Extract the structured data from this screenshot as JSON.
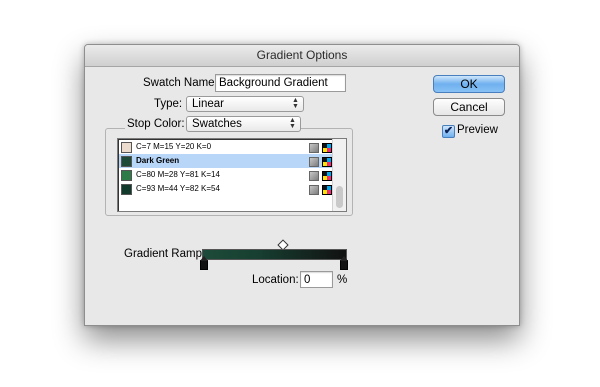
{
  "window": {
    "title": "Gradient Options"
  },
  "swatch_name": {
    "label": "Swatch Name:",
    "value": "Background Gradient"
  },
  "type": {
    "label": "Type:",
    "selected": "Linear"
  },
  "stop_color": {
    "label": "Stop Color:",
    "selected": "Swatches"
  },
  "swatches": [
    {
      "name": "C=7 M=15 Y=20 K=0",
      "color": "#ebdccd",
      "selected": false
    },
    {
      "name": "Dark Green",
      "color": "#1d4a38",
      "selected": true
    },
    {
      "name": "C=80 M=28 Y=81 K=14",
      "color": "#2f7b48",
      "selected": false
    },
    {
      "name": "C=93 M=44 Y=82 K=54",
      "color": "#123a2c",
      "selected": false
    }
  ],
  "gradient_ramp": {
    "label": "Gradient Ramp"
  },
  "location": {
    "label": "Location:",
    "value": "0",
    "unit": "%"
  },
  "buttons": {
    "ok": "OK",
    "cancel": "Cancel"
  },
  "preview": {
    "label": "Preview",
    "checked": true,
    "check_glyph": "✔"
  },
  "icons": {
    "popup_arrows": "⌃⌄",
    "tint_icon": "tint-swatch-icon",
    "cmyk_icon": "process-color-icon"
  }
}
